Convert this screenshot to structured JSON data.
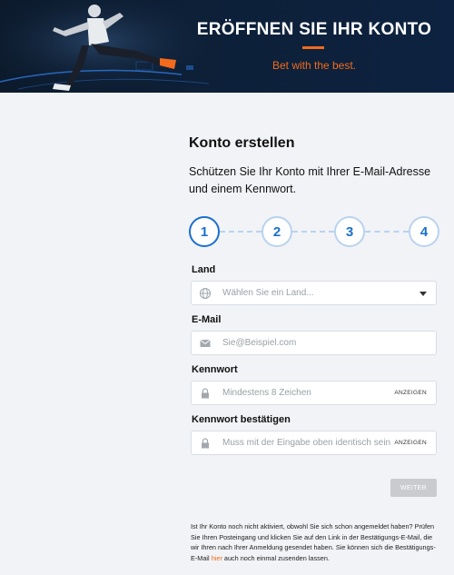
{
  "hero": {
    "title": "ERÖFFNEN SIE IHR KONTO",
    "subtitle": "Bet with the best.",
    "accent_color": "#f26a1b",
    "background_color": "#0d2038"
  },
  "main": {
    "heading": "Konto erstellen",
    "intro": "Schützen Sie Ihr Konto mit Ihrer E-Mail-Adresse und einem Kennwort."
  },
  "stepper": {
    "active_step": 1,
    "steps": [
      "1",
      "2",
      "3",
      "4"
    ]
  },
  "form": {
    "country": {
      "label": "Land",
      "placeholder": "Wählen Sie ein Land...",
      "icon": "globe-icon"
    },
    "email": {
      "label": "E-Mail",
      "placeholder": "Sie@Beispiel.com",
      "icon": "envelope-icon"
    },
    "password": {
      "label": "Kennwort",
      "placeholder": "Mindestens 8 Zeichen",
      "show_label": "ANZEIGEN",
      "icon": "lock-icon"
    },
    "password_confirm": {
      "label": "Kennwort bestätigen",
      "placeholder": "Muss mit der Eingabe oben identisch sein",
      "show_label": "ANZEIGEN",
      "icon": "lock-icon"
    },
    "next_label": "WEITER"
  },
  "footnote": {
    "text": "Ist Ihr Konto noch nicht aktiviert, obwohl Sie sich schon angemeldet haben? Prüfen Sie Ihren Posteingang und klicken Sie auf den Link in der Bestätigungs-E-Mail, die wir Ihren nach Ihrer Anmeldung gesendet haben. Sie können sich die Bestätigungs-E-Mail ",
    "link": "hier",
    "text_after": " auch noch einmal zusenden lassen."
  }
}
